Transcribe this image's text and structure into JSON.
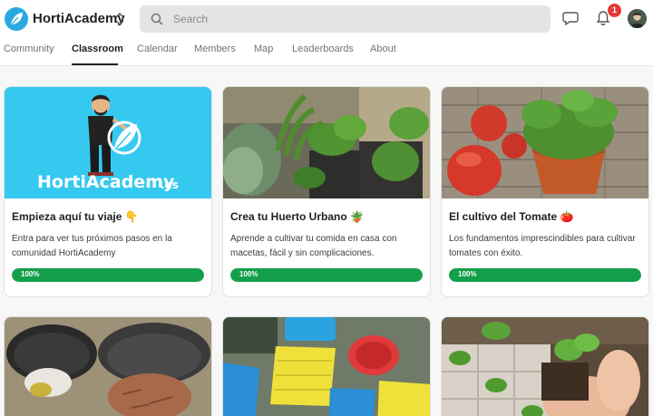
{
  "app": {
    "name": "HortiAcademy"
  },
  "search": {
    "placeholder": "Search"
  },
  "notifications": {
    "count": "1"
  },
  "tabs": [
    {
      "label": "Community",
      "active": false
    },
    {
      "label": "Classroom",
      "active": true
    },
    {
      "label": "Calendar",
      "active": false
    },
    {
      "label": "Members",
      "active": false
    },
    {
      "label": "Map",
      "active": false
    },
    {
      "label": "Leaderboards",
      "active": false
    },
    {
      "label": "About",
      "active": false
    }
  ],
  "courses": [
    {
      "title": "Empieza aquí tu viaje 👇",
      "description": "Entra para ver tus próximos pasos en la comunidad HortiAcademy",
      "progress_label": "100%",
      "progress": 1.0,
      "image": {
        "kind": "logo-banner",
        "logo_text": "HortiAcademy",
        "logo_suffix": ".es",
        "bg": "#36c9f0"
      }
    },
    {
      "title": "Crea tu Huerto Urbano 🪴",
      "description": "Aprende a cultivar tu comida en casa con macetas, fácil y sin complicaciones.",
      "progress_label": "100%",
      "progress": 1.0,
      "image": {
        "kind": "photo-pot-plants"
      }
    },
    {
      "title": "El cultivo del Tomate 🍅",
      "description": "Los fundamentos imprescindibles para cultivar tomates con éxito.",
      "progress_label": "100%",
      "progress": 1.0,
      "image": {
        "kind": "photo-tomato-plant"
      }
    },
    {
      "image": {
        "kind": "photo-compost-bins"
      }
    },
    {
      "image": {
        "kind": "photo-seed-trays"
      }
    },
    {
      "image": {
        "kind": "photo-seedlings"
      }
    }
  ],
  "colors": {
    "accent": "#14a04a",
    "badge": "#e53935",
    "brand_blue": "#2aa8e0"
  }
}
